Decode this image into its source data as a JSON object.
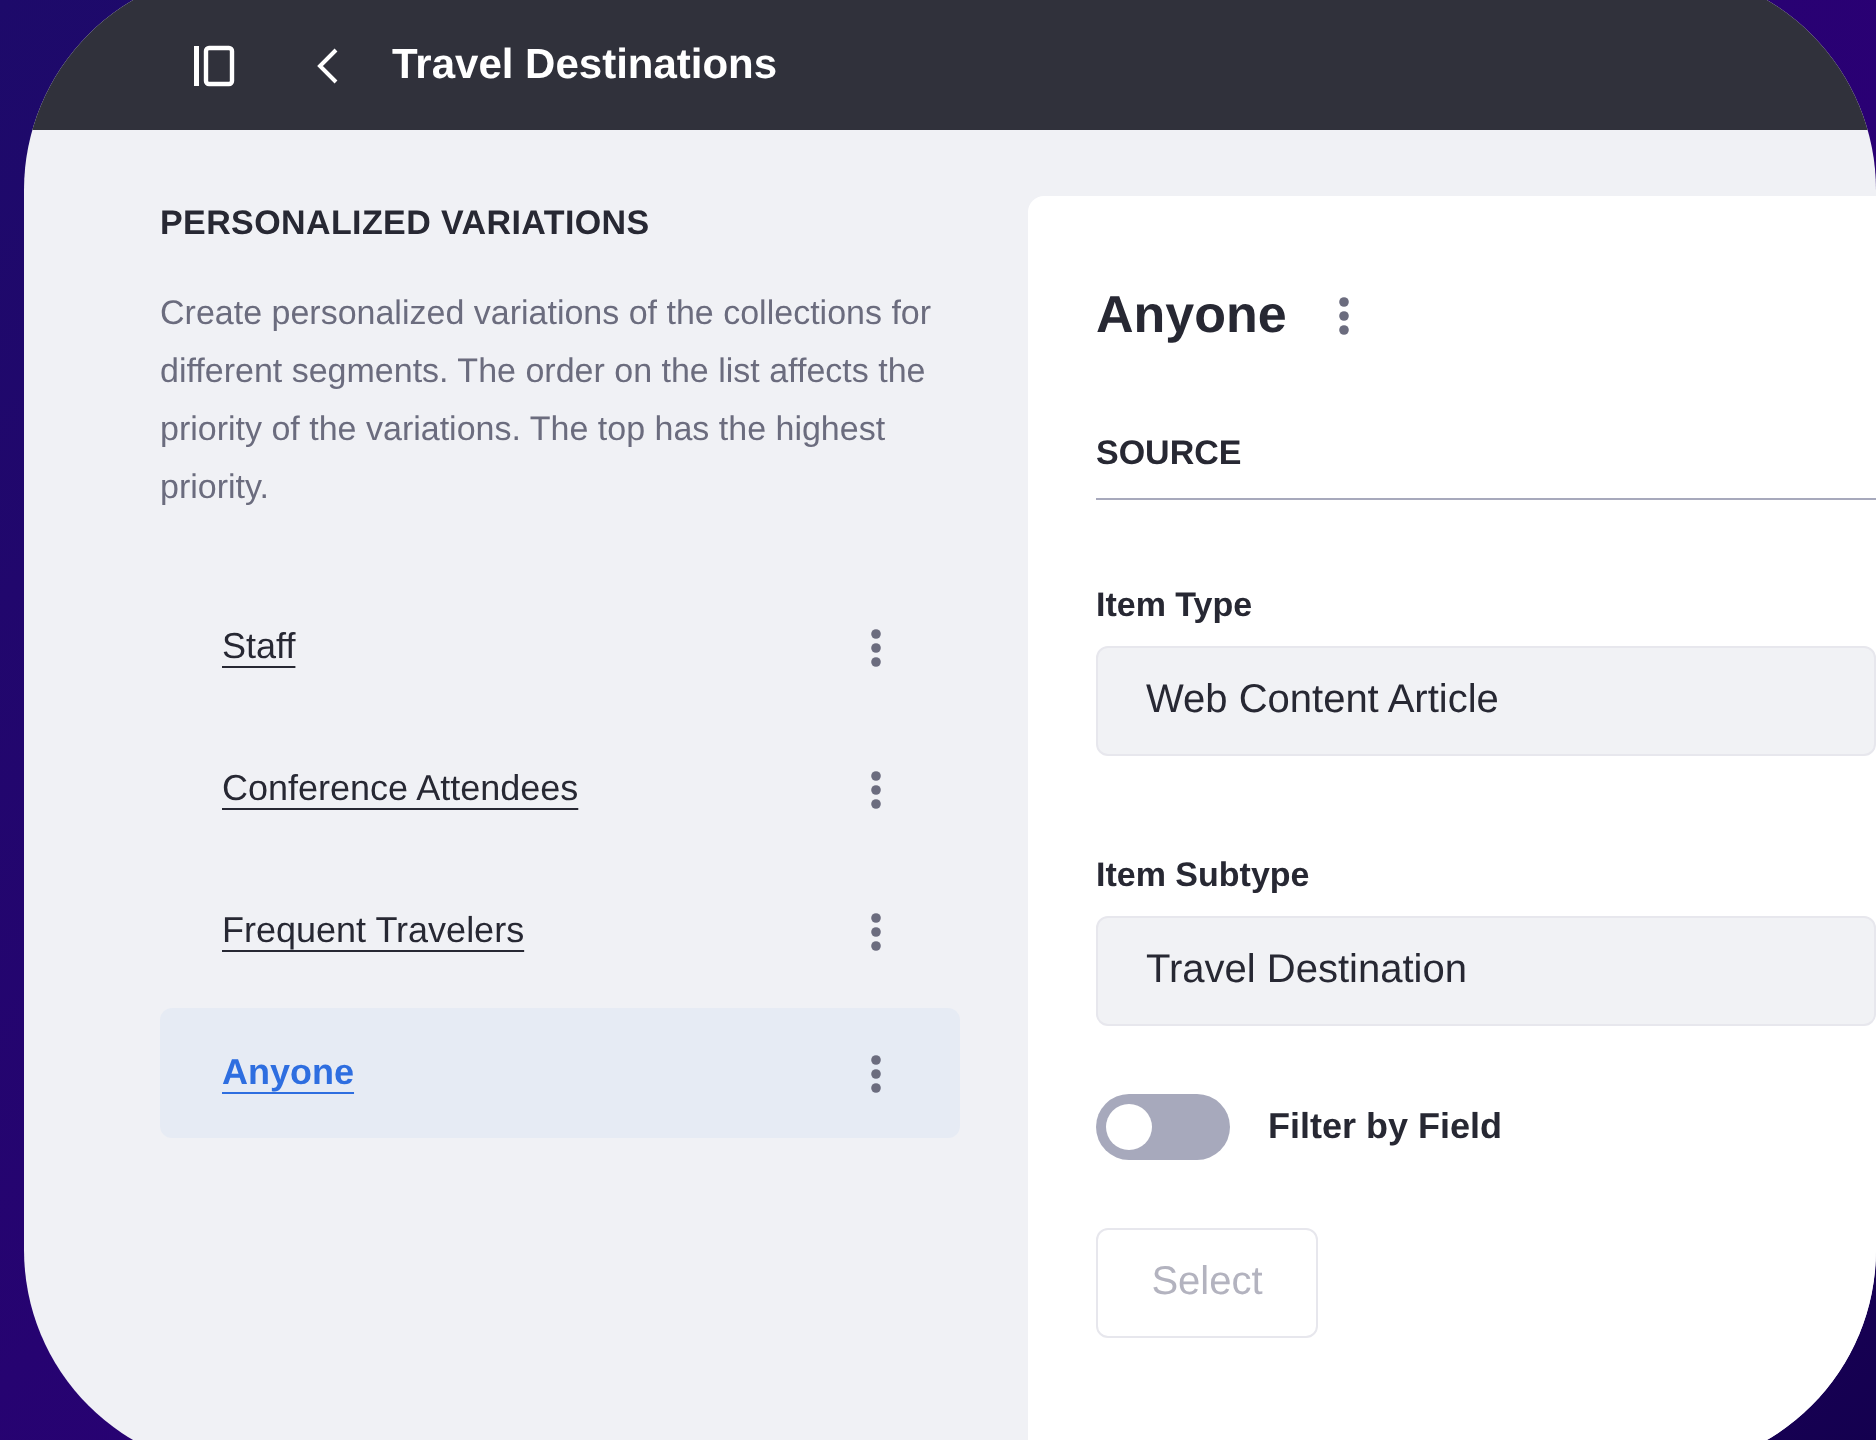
{
  "header": {
    "title": "Travel Destinations"
  },
  "sidebar": {
    "heading": "PERSONALIZED VARIATIONS",
    "description": "Create personalized variations of the collections for different segments. The order on the list affects the priority of the variations. The top has the highest priority.",
    "variations": [
      {
        "label": "Staff",
        "selected": false
      },
      {
        "label": "Conference Attendees",
        "selected": false
      },
      {
        "label": "Frequent Travelers",
        "selected": false
      },
      {
        "label": "Anyone",
        "selected": true
      }
    ]
  },
  "detail": {
    "title": "Anyone",
    "section": "SOURCE",
    "fields": [
      {
        "label": "Item Type",
        "value": "Web Content Article"
      },
      {
        "label": "Item Subtype",
        "value": "Travel Destination"
      }
    ],
    "filter_toggle": {
      "label": "Filter by Field",
      "on": false
    },
    "select_button": {
      "label": "Select",
      "disabled": true
    }
  }
}
